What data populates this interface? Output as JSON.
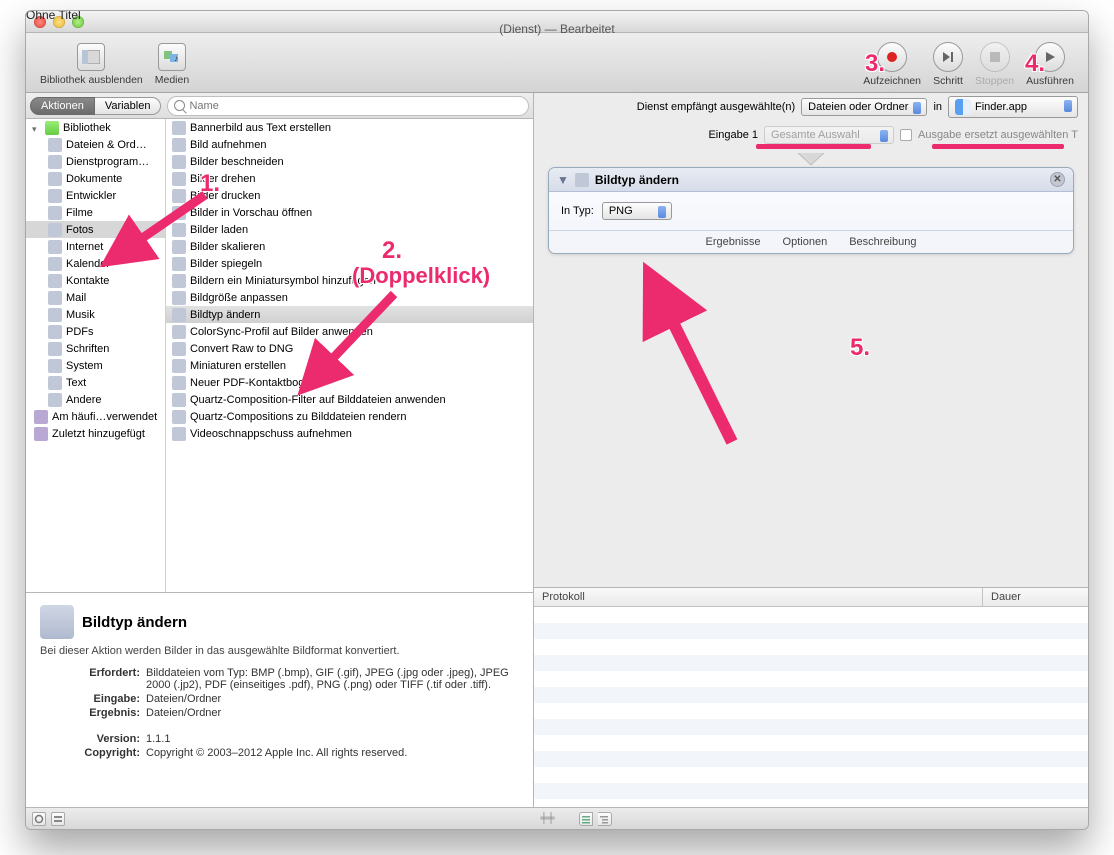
{
  "title": {
    "main": "Ohne Titel",
    "paren": "(Dienst)",
    "suffix": "— Bearbeitet"
  },
  "toolbar": {
    "hide_library": "Bibliothek ausblenden",
    "media": "Medien",
    "record": "Aufzeichnen",
    "step": "Schritt",
    "stop": "Stoppen",
    "run": "Ausführen"
  },
  "tabs": {
    "actions": "Aktionen",
    "variables": "Variablen"
  },
  "search_placeholder": "Name",
  "library_root": "Bibliothek",
  "library_items": [
    "Dateien & Ord…",
    "Dienstprogram…",
    "Dokumente",
    "Entwickler",
    "Filme",
    "Fotos",
    "Internet",
    "Kalender",
    "Kontakte",
    "Mail",
    "Musik",
    "PDFs",
    "Schriften",
    "System",
    "Text",
    "Andere"
  ],
  "library_extra": [
    "Am häufi…verwendet",
    "Zuletzt hinzugefügt"
  ],
  "actions_list": [
    "Bannerbild aus Text erstellen",
    "Bild aufnehmen",
    "Bilder beschneiden",
    "Bilder drehen",
    "Bilder drucken",
    "Bilder in Vorschau öffnen",
    "Bilder laden",
    "Bilder skalieren",
    "Bilder spiegeln",
    "Bildern ein Miniatursymbol hinzufügen",
    "Bildgröße anpassen",
    "Bildtyp ändern",
    "ColorSync-Profil auf Bilder anwenden",
    "Convert Raw to DNG",
    "Miniaturen erstellen",
    "Neuer PDF-Kontaktbogen",
    "Quartz-Composition-Filter auf Bilddateien anwenden",
    "Quartz-Compositions zu Bilddateien rendern",
    "Videoschnappschuss aufnehmen"
  ],
  "selected_action_index": 11,
  "info": {
    "title": "Bildtyp ändern",
    "desc": "Bei dieser Aktion werden Bilder in das ausgewählte Bildformat konvertiert.",
    "required_label": "Erfordert:",
    "required": "Bilddateien vom Typ: BMP (.bmp), GIF (.gif), JPEG (.jpg oder .jpeg), JPEG 2000 (.jp2), PDF (einseitiges .pdf), PNG (.png) oder TIFF (.tif oder .tiff).",
    "input_label": "Eingabe:",
    "input": "Dateien/Ordner",
    "result_label": "Ergebnis:",
    "result": "Dateien/Ordner",
    "version_label": "Version:",
    "version": "1.1.1",
    "copyright_label": "Copyright:",
    "copyright": "Copyright © 2003–2012 Apple Inc.  All rights reserved."
  },
  "service": {
    "receives_label": "Dienst empfängt ausgewählte(n)",
    "receives_value": "Dateien oder Ordner",
    "in_label": "in",
    "app_value": "Finder.app",
    "input_label": "Eingabe 1",
    "input_value": "Gesamte Auswahl",
    "replace_label": "Ausgabe ersetzt ausgewählten T"
  },
  "action_card": {
    "title": "Bildtyp ändern",
    "intype_label": "In Typ:",
    "intype_value": "PNG",
    "foot_results": "Ergebnisse",
    "foot_options": "Optionen",
    "foot_desc": "Beschreibung"
  },
  "log": {
    "col1": "Protokoll",
    "col2": "Dauer"
  },
  "annotations": {
    "n1": "1.",
    "n2": "2.",
    "n2b": "(Doppelklick)",
    "n3": "3.",
    "n4": "4.",
    "n5": "5."
  }
}
